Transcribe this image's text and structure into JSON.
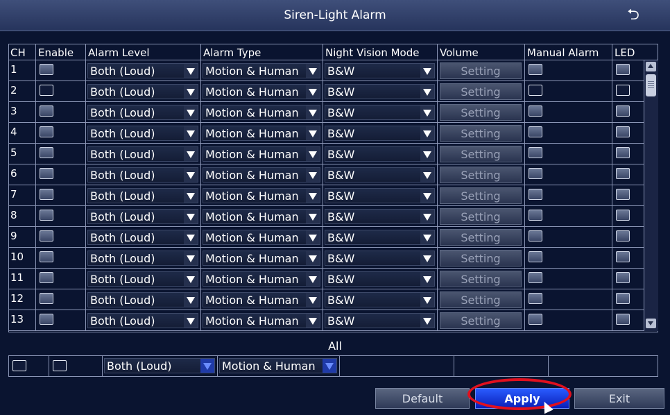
{
  "window": {
    "title": "Siren-Light Alarm",
    "back_icon": "return-icon"
  },
  "columns": [
    "CH",
    "Enable",
    "Alarm Level",
    "Alarm Type",
    "Night Vision Mode",
    "Volume",
    "Manual Alarm",
    "LED"
  ],
  "rows": [
    {
      "ch": "1",
      "alarm_level": "Both (Loud)",
      "alarm_type": "Motion & Human",
      "night_vision": "B&W",
      "volume": "Setting"
    },
    {
      "ch": "2",
      "alarm_level": "Both (Loud)",
      "alarm_type": "Motion & Human",
      "night_vision": "B&W",
      "volume": "Setting"
    },
    {
      "ch": "3",
      "alarm_level": "Both (Loud)",
      "alarm_type": "Motion & Human",
      "night_vision": "B&W",
      "volume": "Setting"
    },
    {
      "ch": "4",
      "alarm_level": "Both (Loud)",
      "alarm_type": "Motion & Human",
      "night_vision": "B&W",
      "volume": "Setting"
    },
    {
      "ch": "5",
      "alarm_level": "Both (Loud)",
      "alarm_type": "Motion & Human",
      "night_vision": "B&W",
      "volume": "Setting"
    },
    {
      "ch": "6",
      "alarm_level": "Both (Loud)",
      "alarm_type": "Motion & Human",
      "night_vision": "B&W",
      "volume": "Setting"
    },
    {
      "ch": "7",
      "alarm_level": "Both (Loud)",
      "alarm_type": "Motion & Human",
      "night_vision": "B&W",
      "volume": "Setting"
    },
    {
      "ch": "8",
      "alarm_level": "Both (Loud)",
      "alarm_type": "Motion & Human",
      "night_vision": "B&W",
      "volume": "Setting"
    },
    {
      "ch": "9",
      "alarm_level": "Both (Loud)",
      "alarm_type": "Motion & Human",
      "night_vision": "B&W",
      "volume": "Setting"
    },
    {
      "ch": "10",
      "alarm_level": "Both (Loud)",
      "alarm_type": "Motion & Human",
      "night_vision": "B&W",
      "volume": "Setting"
    },
    {
      "ch": "11",
      "alarm_level": "Both (Loud)",
      "alarm_type": "Motion & Human",
      "night_vision": "B&W",
      "volume": "Setting"
    },
    {
      "ch": "12",
      "alarm_level": "Both (Loud)",
      "alarm_type": "Motion & Human",
      "night_vision": "B&W",
      "volume": "Setting"
    },
    {
      "ch": "13",
      "alarm_level": "Both (Loud)",
      "alarm_type": "Motion & Human",
      "night_vision": "B&W",
      "volume": "Setting"
    }
  ],
  "all": {
    "label": "All",
    "alarm_level": "Both (Loud)",
    "alarm_type": "Motion & Human"
  },
  "buttons": {
    "default": "Default",
    "apply": "Apply",
    "exit": "Exit"
  },
  "colors": {
    "background": "#0a1430",
    "titlebar": "#2f3d66",
    "apply_button": "#1b3be0",
    "highlight_circle": "#e0101e"
  }
}
